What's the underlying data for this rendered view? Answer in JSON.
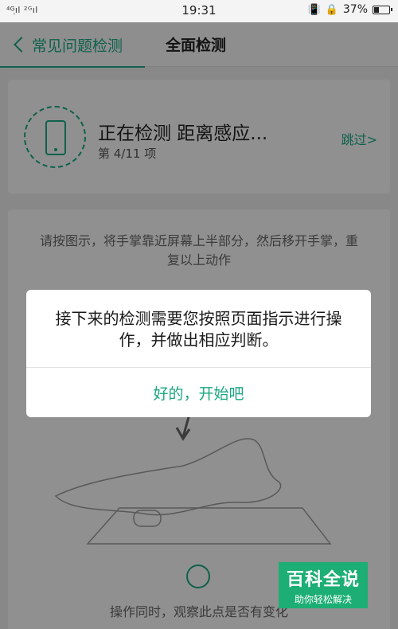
{
  "status_bar": {
    "signal": "⁴ᴳ᷊ıl ²ᴳıl",
    "time": "19:31",
    "icons": [
      "vibrate-icon",
      "lock-rotation-icon"
    ],
    "battery_percent": "37%",
    "battery_level": 0.37
  },
  "nav": {
    "back_label": "常见问题检测",
    "title": "全面检测"
  },
  "detect_card": {
    "icon": "phone-icon",
    "title": "正在检测 距离感应...",
    "progress": "第 4/11 项",
    "skip": "跳过>"
  },
  "instruction_card": {
    "instruction": "请按图示，将手掌靠近屏幕上半部分，然后移开手掌，重复以上动作",
    "observe": "操作同时，观察此点是否有变化"
  },
  "dialog": {
    "message": "接下来的检测需要您按照页面指示进行操作，并做出相应判断。",
    "button": "好的，开始吧"
  },
  "watermark": {
    "title": "百科全说",
    "subtitle": "助你轻松解决"
  },
  "colors": {
    "accent": "#1aa782",
    "watermark": "#1cae74"
  }
}
